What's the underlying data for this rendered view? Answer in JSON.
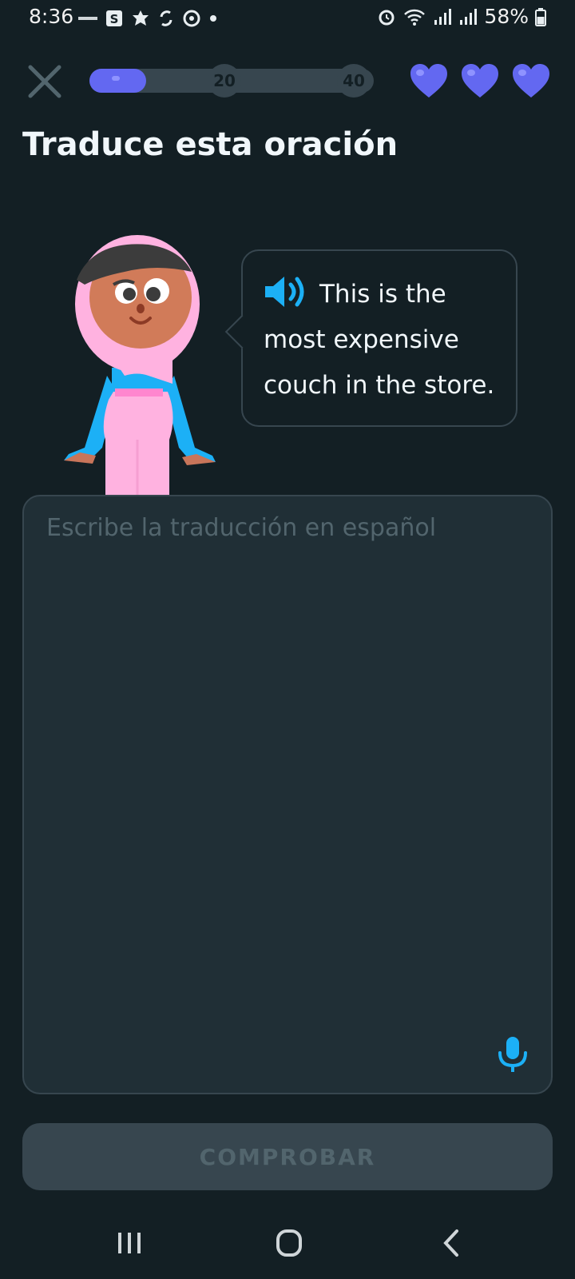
{
  "status_bar": {
    "time": "8:36",
    "battery": "58%",
    "left_icons": [
      "news-icon",
      "s-app-icon",
      "leaf-icon",
      "sync-icon",
      "target-icon",
      "dot-icon"
    ],
    "right_icons": [
      "alarm-icon",
      "wifi-icon",
      "signal-icon",
      "signal-icon",
      "battery-icon"
    ]
  },
  "header": {
    "progress": 0.2,
    "milestones": [
      "20",
      "40"
    ],
    "hearts": 3,
    "colors": {
      "accent": "#6368f1",
      "track": "#37464f"
    }
  },
  "exercise": {
    "title": "Traduce esta oración",
    "prompt_sentence": "This is the most expensive couch in the store.",
    "input_placeholder": "Escribe la traducción en español"
  },
  "actions": {
    "check_label": "COMPROBAR"
  }
}
